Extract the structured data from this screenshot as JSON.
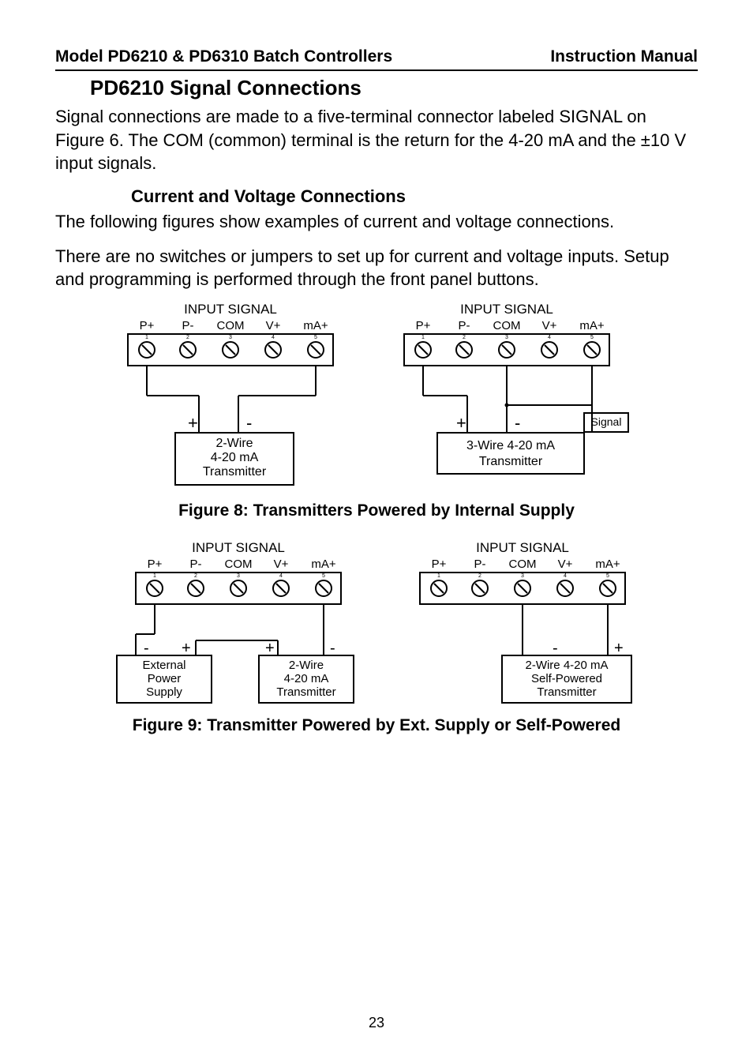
{
  "header": {
    "model": "Model PD6210 & PD6310 Batch Controllers",
    "doc": "Instruction Manual"
  },
  "h1": "PD6210 Signal Connections",
  "para1": "Signal connections are made to a five-terminal connector labeled SIGNAL on Figure 6. The COM (common) terminal is the return for the 4-20 mA and the ±10 V input signals.",
  "h2": "Current and Voltage Connections",
  "para2": "The following figures show examples of current and voltage connections.",
  "para3": "There are no switches or jumpers to set up for current and voltage inputs. Setup and programming is performed through the front panel buttons.",
  "fig8": {
    "caption": "Figure 8: Transmitters Powered by Internal Supply",
    "left": {
      "title": "INPUT SIGNAL",
      "labels": [
        "P+",
        "P-",
        "COM",
        "V+",
        "mA+"
      ],
      "box": "2-Wire\n4-20 mA\nTransmitter"
    },
    "right": {
      "title": "INPUT SIGNAL",
      "labels": [
        "P+",
        "P-",
        "COM",
        "V+",
        "mA+"
      ],
      "box": "3-Wire 4-20 mA\nTransmitter",
      "sig": "Signal"
    }
  },
  "fig9": {
    "caption": "Figure 9: Transmitter Powered by Ext. Supply or Self-Powered",
    "left": {
      "title": "INPUT SIGNAL",
      "labels": [
        "P+",
        "P-",
        "COM",
        "V+",
        "mA+"
      ],
      "boxL": "External\nPower\nSupply",
      "boxR": "2-Wire\n4-20 mA\nTransmitter"
    },
    "right": {
      "title": "INPUT SIGNAL",
      "labels": [
        "P+",
        "P-",
        "COM",
        "V+",
        "mA+"
      ],
      "box": "2-Wire 4-20 mA\nSelf-Powered\nTransmitter"
    }
  },
  "page": "23"
}
